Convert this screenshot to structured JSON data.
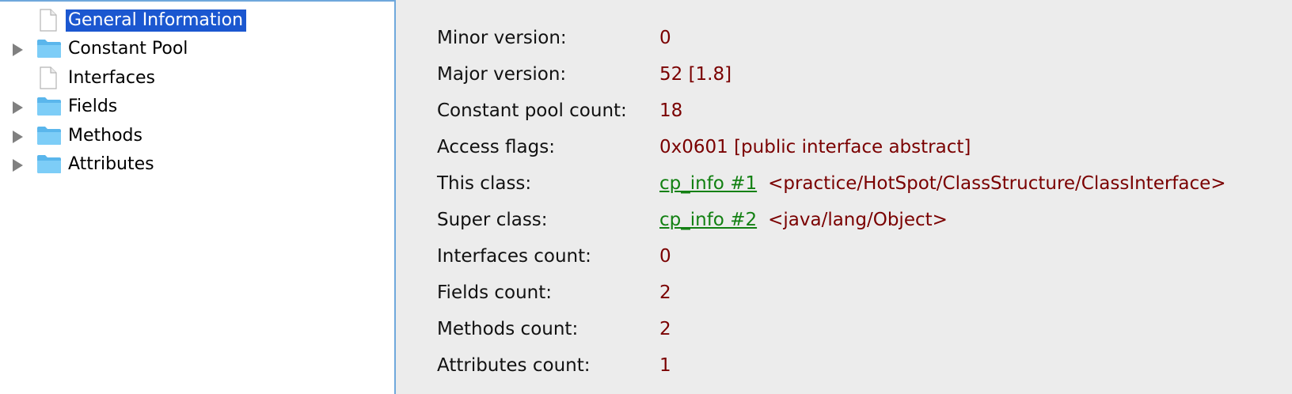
{
  "tree": {
    "items": [
      {
        "label": "General Information",
        "icon": "file-icon",
        "expandable": false,
        "selected": true
      },
      {
        "label": "Constant Pool",
        "icon": "folder-icon",
        "expandable": true,
        "selected": false
      },
      {
        "label": "Interfaces",
        "icon": "file-icon",
        "expandable": false,
        "selected": false
      },
      {
        "label": "Fields",
        "icon": "folder-icon",
        "expandable": true,
        "selected": false
      },
      {
        "label": "Methods",
        "icon": "folder-icon",
        "expandable": true,
        "selected": false
      },
      {
        "label": "Attributes",
        "icon": "folder-icon",
        "expandable": true,
        "selected": false
      }
    ]
  },
  "info": {
    "minor_version": {
      "key": "Minor version:",
      "value": "0"
    },
    "major_version": {
      "key": "Major version:",
      "value": "52 [1.8]"
    },
    "constant_pool_count": {
      "key": "Constant pool count:",
      "value": "18"
    },
    "access_flags": {
      "key": "Access flags:",
      "value": "0x0601 [public interface abstract]"
    },
    "this_class": {
      "key": "This class:",
      "link": "cp_info #1",
      "desc": "<practice/HotSpot/ClassStructure/ClassInterface>"
    },
    "super_class": {
      "key": "Super class:",
      "link": "cp_info #2",
      "desc": "<java/lang/Object>"
    },
    "interfaces_count": {
      "key": "Interfaces count:",
      "value": "0"
    },
    "fields_count": {
      "key": "Fields count:",
      "value": "2"
    },
    "methods_count": {
      "key": "Methods count:",
      "value": "2"
    },
    "attributes_count": {
      "key": "Attributes count:",
      "value": "1"
    }
  },
  "colors": {
    "selection": "#1b57d0",
    "value_text": "#7a0000",
    "link_text": "#128012",
    "panel_border": "#6fa8dc",
    "folder": "#6cc4f5"
  }
}
